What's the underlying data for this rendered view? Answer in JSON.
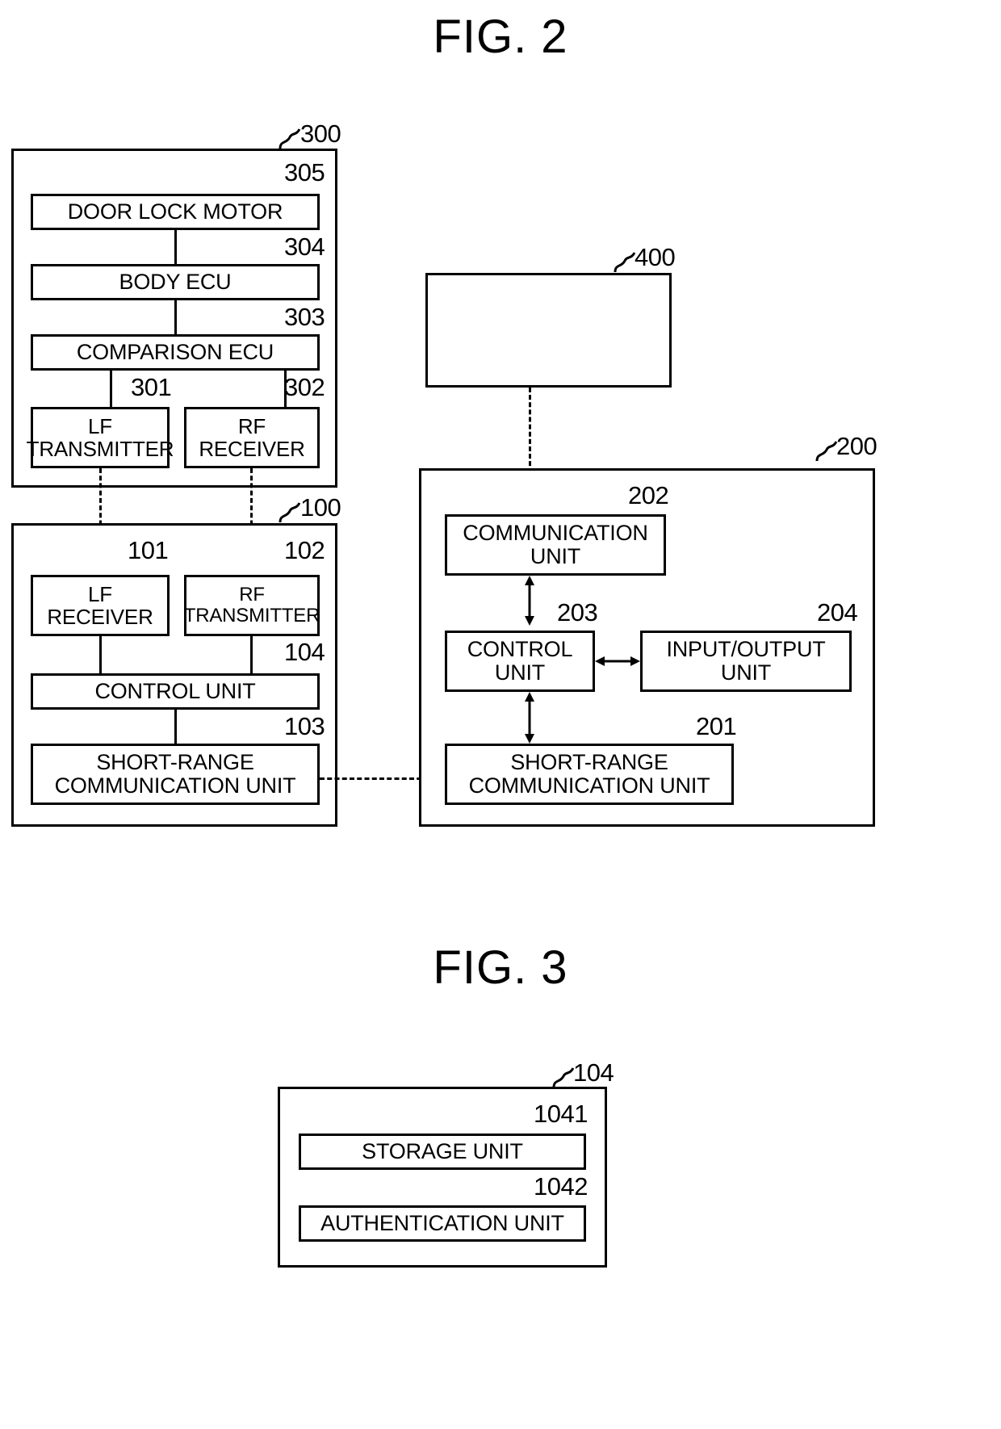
{
  "figures": [
    {
      "title": "FIG. 2",
      "blocks": [
        {
          "ref": "300",
          "name": "vehicle-unit",
          "children": [
            {
              "ref": "305",
              "label": "DOOR LOCK MOTOR"
            },
            {
              "ref": "304",
              "label": "BODY ECU"
            },
            {
              "ref": "303",
              "label": "COMPARISON ECU"
            },
            {
              "ref": "301",
              "label": "LF\nTRANSMITTER",
              "line1": "LF",
              "line2": "TRANSMITTER"
            },
            {
              "ref": "302",
              "label": "RF\nRECEIVER",
              "line1": "RF",
              "line2": "RECEIVER"
            }
          ]
        },
        {
          "ref": "100",
          "name": "portable-device",
          "children": [
            {
              "ref": "101",
              "label": "LF\nRECEIVER",
              "line1": "LF",
              "line2": "RECEIVER"
            },
            {
              "ref": "102",
              "label": "RF\nTRANSMITTER",
              "line1": "RF",
              "line2": "TRANSMITTER"
            },
            {
              "ref": "104",
              "label": "CONTROL UNIT"
            },
            {
              "ref": "103",
              "label": "SHORT-RANGE\nCOMMUNICATION UNIT",
              "line1": "SHORT-RANGE",
              "line2": "COMMUNICATION UNIT"
            }
          ]
        },
        {
          "ref": "400",
          "name": "server",
          "children": []
        },
        {
          "ref": "200",
          "name": "mobile-terminal",
          "children": [
            {
              "ref": "202",
              "label": "COMMUNICATION\nUNIT",
              "line1": "COMMUNICATION",
              "line2": "UNIT"
            },
            {
              "ref": "203",
              "label": "CONTROL\nUNIT",
              "line1": "CONTROL",
              "line2": "UNIT"
            },
            {
              "ref": "204",
              "label": "INPUT/OUTPUT\nUNIT",
              "line1": "INPUT/OUTPUT",
              "line2": "UNIT"
            },
            {
              "ref": "201",
              "label": "SHORT-RANGE\nCOMMUNICATION UNIT",
              "line1": "SHORT-RANGE",
              "line2": "COMMUNICATION UNIT"
            }
          ]
        }
      ]
    },
    {
      "title": "FIG. 3",
      "blocks": [
        {
          "ref": "104",
          "name": "control-unit-detail",
          "children": [
            {
              "ref": "1041",
              "label": "STORAGE UNIT"
            },
            {
              "ref": "1042",
              "label": "AUTHENTICATION UNIT"
            }
          ]
        }
      ]
    }
  ],
  "fig2": {
    "title": "FIG. 2",
    "vehicle": {
      "ref": "300",
      "door_lock_motor": {
        "ref": "305",
        "label": "DOOR LOCK MOTOR"
      },
      "body_ecu": {
        "ref": "304",
        "label": "BODY ECU"
      },
      "comparison_ecu": {
        "ref": "303",
        "label": "COMPARISON ECU"
      },
      "lf_transmitter": {
        "ref": "301",
        "line1": "LF",
        "line2": "TRANSMITTER"
      },
      "rf_receiver": {
        "ref": "302",
        "line1": "RF",
        "line2": "RECEIVER"
      }
    },
    "portable": {
      "ref": "100",
      "lf_receiver": {
        "ref": "101",
        "line1": "LF",
        "line2": "RECEIVER"
      },
      "rf_transmitter": {
        "ref": "102",
        "line1": "RF",
        "line2": "TRANSMITTER"
      },
      "control_unit": {
        "ref": "104",
        "label": "CONTROL UNIT"
      },
      "short_range": {
        "ref": "103",
        "line1": "SHORT-RANGE",
        "line2": "COMMUNICATION UNIT"
      }
    },
    "server": {
      "ref": "400"
    },
    "terminal": {
      "ref": "200",
      "communication_unit": {
        "ref": "202",
        "line1": "COMMUNICATION",
        "line2": "UNIT"
      },
      "control_unit": {
        "ref": "203",
        "line1": "CONTROL",
        "line2": "UNIT"
      },
      "io_unit": {
        "ref": "204",
        "line1": "INPUT/OUTPUT",
        "line2": "UNIT"
      },
      "short_range": {
        "ref": "201",
        "line1": "SHORT-RANGE",
        "line2": "COMMUNICATION UNIT"
      }
    }
  },
  "fig3": {
    "title": "FIG. 3",
    "control_unit": {
      "ref": "104"
    },
    "storage_unit": {
      "ref": "1041",
      "label": "STORAGE UNIT"
    },
    "authentication_unit": {
      "ref": "1042",
      "label": "AUTHENTICATION UNIT"
    }
  }
}
